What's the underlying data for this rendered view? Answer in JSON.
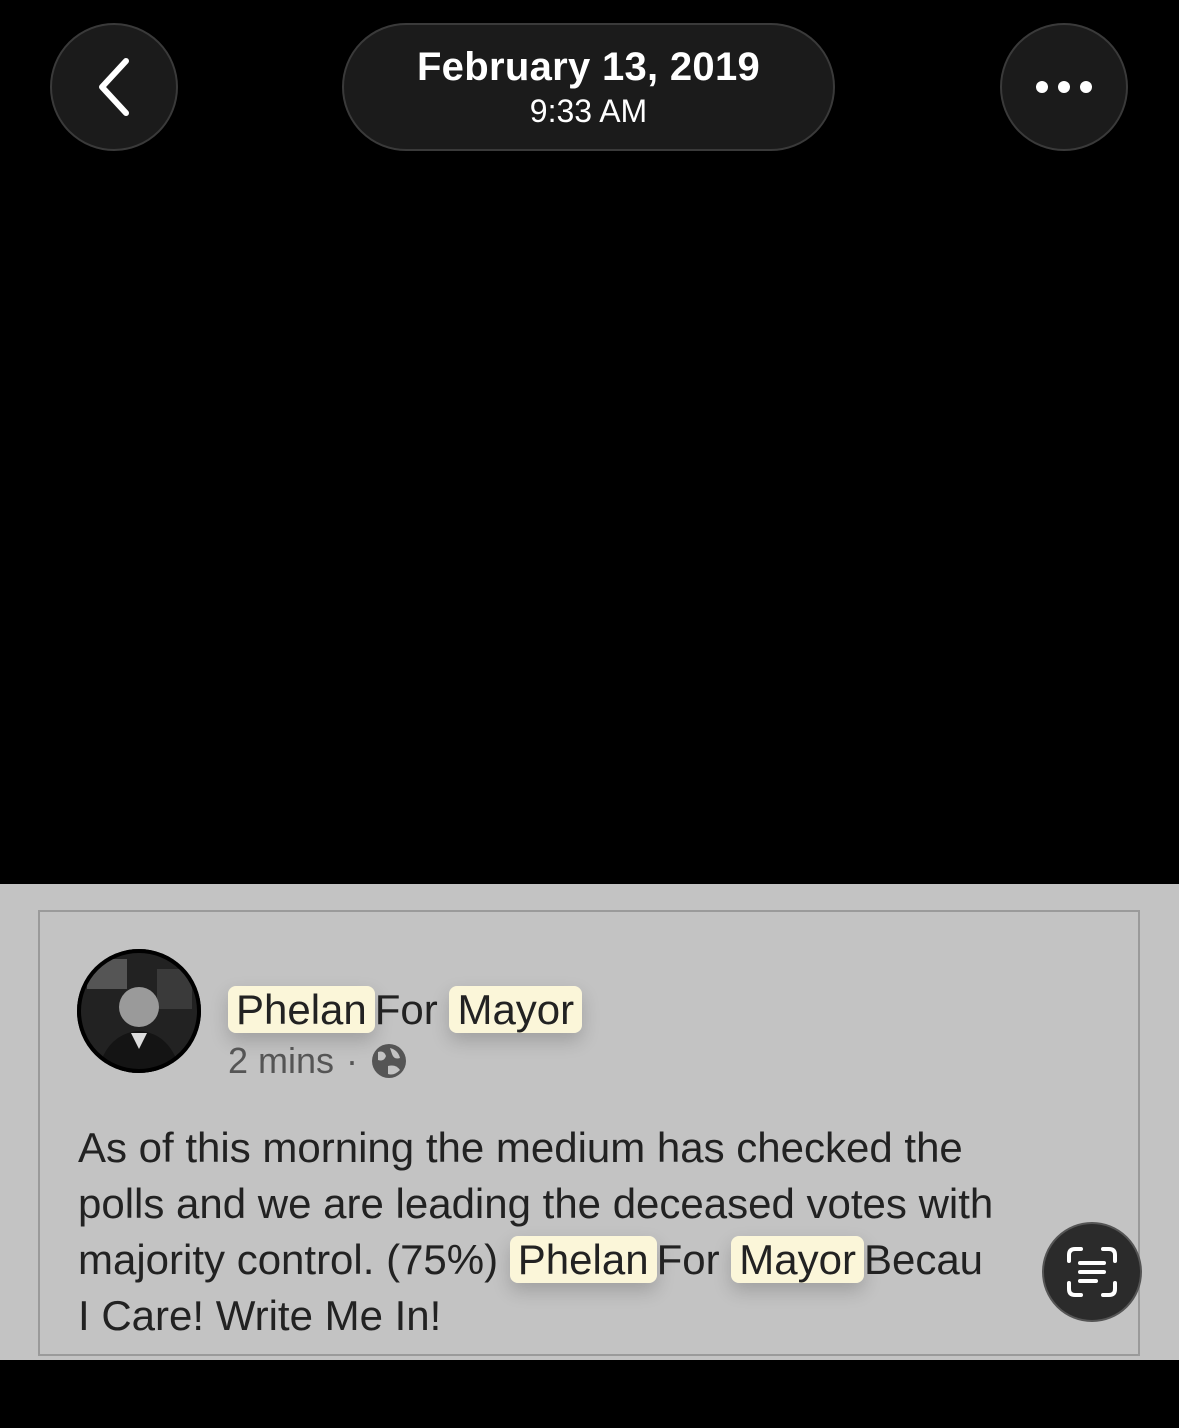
{
  "header": {
    "date": "February 13, 2019",
    "time": "9:33 AM"
  },
  "icons": {
    "back": "chevron-left-icon",
    "more": "ellipsis-icon",
    "live_text": "live-text-icon",
    "globe": "globe-icon"
  },
  "post": {
    "name_part1": "Phelan",
    "name_part2": "For",
    "name_part3": "Mayor",
    "time_ago": "2 mins",
    "separator": "·",
    "line1": "As of this morning the medium has checked the",
    "line2": "polls and we are leading the deceased votes with",
    "line3_prefix": "majority control. (75%)",
    "line3_name1": "Phelan",
    "line3_for": "For",
    "line3_name2": "Mayor",
    "line3_suffix": "Becau",
    "line4": "I Care! Write Me In!"
  },
  "colors": {
    "highlight": "#fbf6d9",
    "photo_bg": "#c3c3c3",
    "button_bg": "#1b1b1b"
  }
}
